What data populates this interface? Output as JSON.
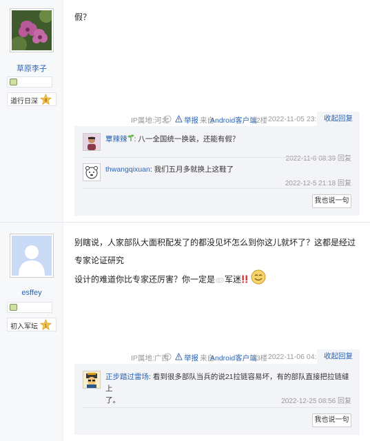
{
  "posts": [
    {
      "user": {
        "name": "草原李子",
        "level_title": "道行日深",
        "level_num": "8"
      },
      "content": "假？",
      "meta": {
        "ip": "IP属地:河北",
        "report": "举报",
        "from": "来自",
        "client": "Android客户端",
        "floor": "12楼",
        "time": "2022-11-05 23:15",
        "collapse": "收起回复"
      },
      "replies": [
        {
          "user": "覃辣辣",
          "text": ": 八一全国统一换装，还能有假？",
          "time": "2022-11-6 08:39",
          "reply": "回复"
        },
        {
          "user": "thwangqixuan",
          "text": ": 我们五月多就换上这鞋了",
          "time": "2022-12-5 21:18",
          "reply": "回复"
        }
      ],
      "say_button": "我也说一句"
    },
    {
      "user": {
        "name": "esffey",
        "level_title": "初入军坛",
        "level_num": "1"
      },
      "content_line1": "别瞎说，人家部队大面积配发了的都没见坏怎么到你这儿就坏了？这都是经过专家论证研究",
      "content_line2": "设计的难道你比专家还厉害？你一定是",
      "content_tail": "军迷",
      "meta": {
        "ip": "IP属地:广西",
        "report": "举报",
        "from": "来自",
        "client": "Android客户端",
        "floor": "13楼",
        "time": "2022-11-06 04:45",
        "collapse": "收起回复"
      },
      "replies": [
        {
          "user": "正步踏过雷场",
          "text_line1": ": 看到很多部队当兵的说21拉链容易坏，有的部队直接把拉链缝上",
          "text_line2": "了。",
          "time": "2022-12-25 08:56",
          "reply": "回复"
        }
      ],
      "say_button": "我也说一句"
    }
  ],
  "colors": {
    "link": "#2d64b3",
    "muted": "#999999",
    "panel": "#f3f4f7"
  },
  "icons": [
    "flower-avatar",
    "default-avatar",
    "badge-icon",
    "star-level-icon",
    "help-circle-icon",
    "warning-icon",
    "smile-emoji",
    "cloud-emoji",
    "exclamation-emoji",
    "sprout-emoji"
  ]
}
